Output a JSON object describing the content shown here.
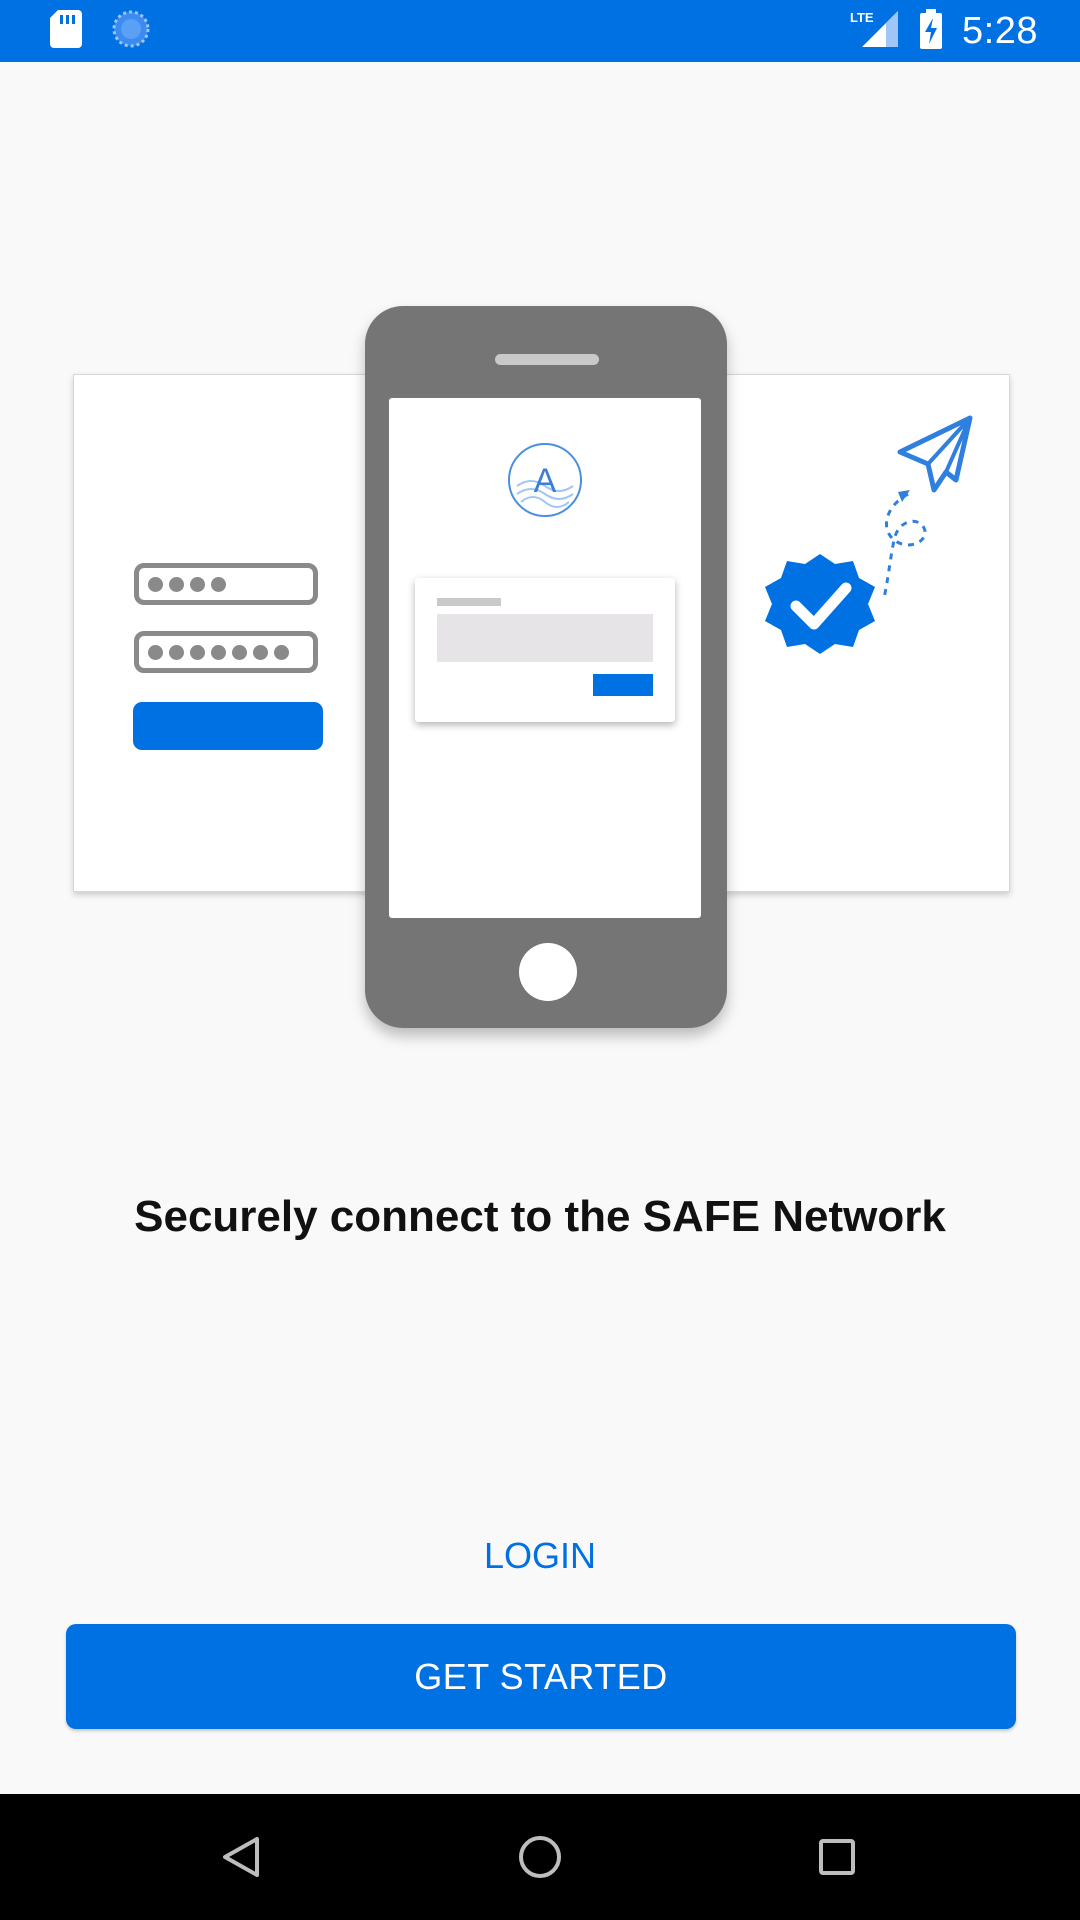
{
  "status_bar": {
    "time": "5:28",
    "network_label": "LTE",
    "icons": [
      "sd-card-icon",
      "sync-icon",
      "lte-signal-icon",
      "battery-charging-icon"
    ],
    "background_color": "#0071e3"
  },
  "illustration": {
    "left_panel": {
      "pin_dots": 4,
      "password_dots": 7
    },
    "phone_logo_letter": "A",
    "right_panel": {
      "icons": [
        "paper-plane-icon",
        "verified-badge-icon"
      ]
    }
  },
  "headline": "Securely connect to the SAFE Network",
  "actions": {
    "login_label": "LOGIN",
    "get_started_label": "GET STARTED"
  },
  "nav_bar": {
    "icons": [
      "back-icon",
      "home-icon",
      "recents-icon"
    ]
  },
  "colors": {
    "accent": "#0071e3",
    "background": "#f9f9f9",
    "phone_body": "#757575",
    "text": "#111111"
  }
}
